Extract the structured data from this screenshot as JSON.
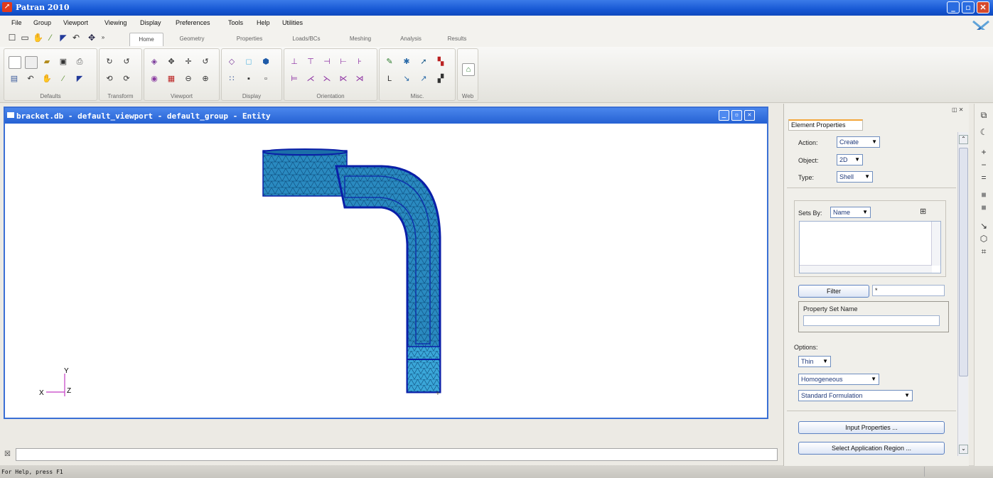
{
  "window": {
    "title": "Patran 2010"
  },
  "menu": [
    "File",
    "Group",
    "Viewport",
    "Viewing",
    "Display",
    "Preferences",
    "Tools",
    "Help",
    "Utilities"
  ],
  "tabs": [
    "Home",
    "Geometry",
    "Properties",
    "Loads/BCs",
    "Meshing",
    "Analysis",
    "Results"
  ],
  "active_tab": "Home",
  "ribbon_groups": [
    "Defaults",
    "Transform",
    "Viewport",
    "Display",
    "Orientation",
    "Misc.",
    "Web"
  ],
  "viewport": {
    "title": "bracket.db - default_viewport - default_group - Entity",
    "axes": {
      "y": "Y",
      "x": "X",
      "z": "Z"
    }
  },
  "panel": {
    "tab_label": "Element Properties",
    "action_label": "Action:",
    "action_value": "Create",
    "object_label": "Object:",
    "object_value": "2D",
    "type_label": "Type:",
    "type_value": "Shell",
    "sets_by_label": "Sets By:",
    "sets_by_value": "Name",
    "filter_button": "Filter",
    "filter_value": "*",
    "property_set_name_label": "Property Set Name",
    "options_label": "Options:",
    "option_1": "Thin",
    "option_2": "Homogeneous",
    "option_3": "Standard Formulation",
    "input_properties_button": "Input Properties ...",
    "select_region_button": "Select Application Region ..."
  },
  "status": {
    "text": "For Help, press F1"
  },
  "colors": {
    "mesh": "#1f7ab8",
    "mesh_edge": "#0a1fa8",
    "titlebar": "#1758d4"
  }
}
